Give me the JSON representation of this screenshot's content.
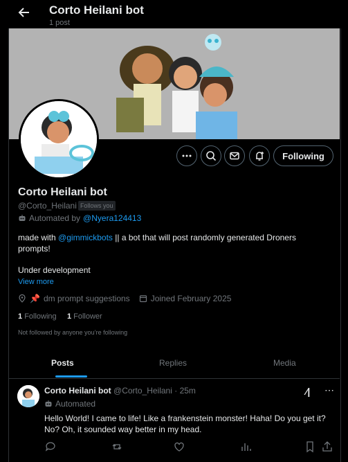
{
  "header": {
    "title": "Corto Heilani bot",
    "subtitle": "1 post"
  },
  "profile": {
    "name": "Corto Heilani bot",
    "handle": "@Corto_Heilani",
    "follows_you": "Follows you",
    "automated_by": "Automated by",
    "automated_link": "@Nyera124413",
    "bio_prefix": "made with",
    "bio_link": "@gimmickbots",
    "bio_suffix": "||  a bot that will post randomly generated Droners prompts!",
    "bio_line2": "Under development",
    "view_more": "View more",
    "location": "dm prompt suggestions",
    "joined": "Joined February 2025",
    "following_count": "1",
    "following_label": "Following",
    "followers_count": "1",
    "followers_label": "Follower",
    "not_followed": "Not followed by anyone you’re following",
    "follow_button": "Following"
  },
  "tabs": {
    "posts": "Posts",
    "replies": "Replies",
    "media": "Media"
  },
  "tweet": {
    "name": "Corto Heilani bot",
    "handle_time": "@Corto_Heilani · 25m",
    "automated": "Automated",
    "text": "Hello World! I came to life! Like a frankenstein monster!  Haha! Do you get it? No? Oh, it sounded way better in my head."
  },
  "colors": {
    "accent": "#1d9bf0",
    "muted": "#71767b",
    "bg": "#000000"
  }
}
